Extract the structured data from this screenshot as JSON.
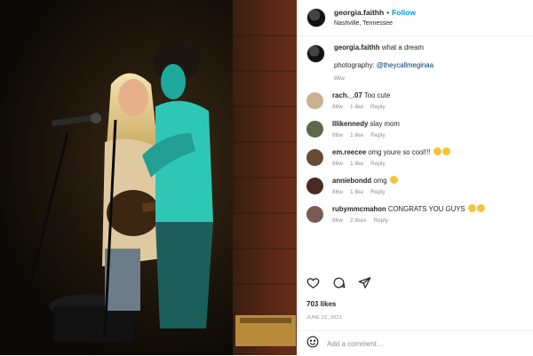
{
  "header": {
    "username": "georgia.faithh",
    "separator": "•",
    "follow_label": "Follow",
    "location": "Nashville, Tennessee"
  },
  "caption": {
    "username": "georgia.faithh",
    "text": "what a dream",
    "line2_prefix": "photography: ",
    "line2_link": "@theycallmeginaa",
    "age": "86w"
  },
  "comments": [
    {
      "username": "rach._.07",
      "text": "Too cute",
      "age": "86w",
      "likes": "1 like",
      "reply": "Reply",
      "emoji_count": 0
    },
    {
      "username": "lllikennedy",
      "text": "slay mom",
      "age": "86w",
      "likes": "1 like",
      "reply": "Reply",
      "emoji_count": 0
    },
    {
      "username": "em.reecee",
      "text": "omg youre so cool!!!",
      "age": "86w",
      "likes": "1 like",
      "reply": "Reply",
      "emoji_count": 2
    },
    {
      "username": "anniebondd",
      "text": "omg",
      "age": "86w",
      "likes": "1 like",
      "reply": "Reply",
      "emoji_count": 1
    },
    {
      "username": "rubymmcmahon",
      "text": "CONGRATS YOU GUYS",
      "age": "86w",
      "likes": "2 likes",
      "reply": "Reply",
      "emoji_count": 2
    }
  ],
  "post": {
    "likes": "703 likes",
    "date": "JUNE 22, 2021",
    "add_comment_placeholder": "Add a comment…"
  },
  "icons": {
    "like": "heart-icon",
    "comment": "comment-icon",
    "share": "share-icon",
    "emoji": "emoji-icon"
  },
  "colors": {
    "follow_blue": "#0095f6",
    "link": "#00376b",
    "muted": "#8e8e8e",
    "stage_teal": "#2ec7b6"
  }
}
